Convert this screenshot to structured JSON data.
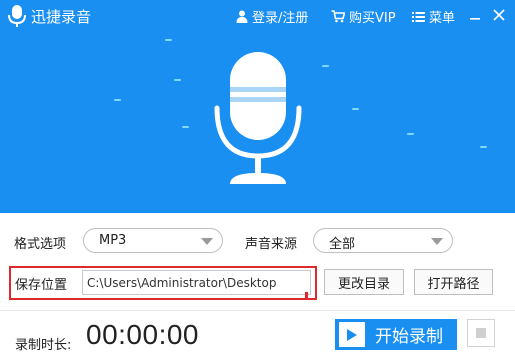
{
  "titlebar": {
    "app_title": "迅捷录音",
    "login": "登录/注册",
    "vip": "购买VIP",
    "menu": "菜单"
  },
  "format": {
    "label": "格式选项",
    "value": "MP3"
  },
  "source": {
    "label": "声音来源",
    "value": "全部"
  },
  "save": {
    "label": "保存位置",
    "path": "C:\\Users\\Administrator\\Desktop",
    "change_dir_button": "更改目录",
    "open_path_button": "打开路径"
  },
  "record": {
    "duration_label": "录制时长:",
    "timer": "00:00:00",
    "start_button": "开始录制"
  },
  "colors": {
    "brand_blue": "#1a8ff2",
    "highlight_red": "#e0292c"
  },
  "icons": [
    "app-mic-logo-icon",
    "user-icon",
    "cart-icon",
    "menu-icon",
    "minimize-icon",
    "close-icon",
    "microphone-illustration",
    "chevron-down-icon",
    "play-icon",
    "stop-icon"
  ]
}
